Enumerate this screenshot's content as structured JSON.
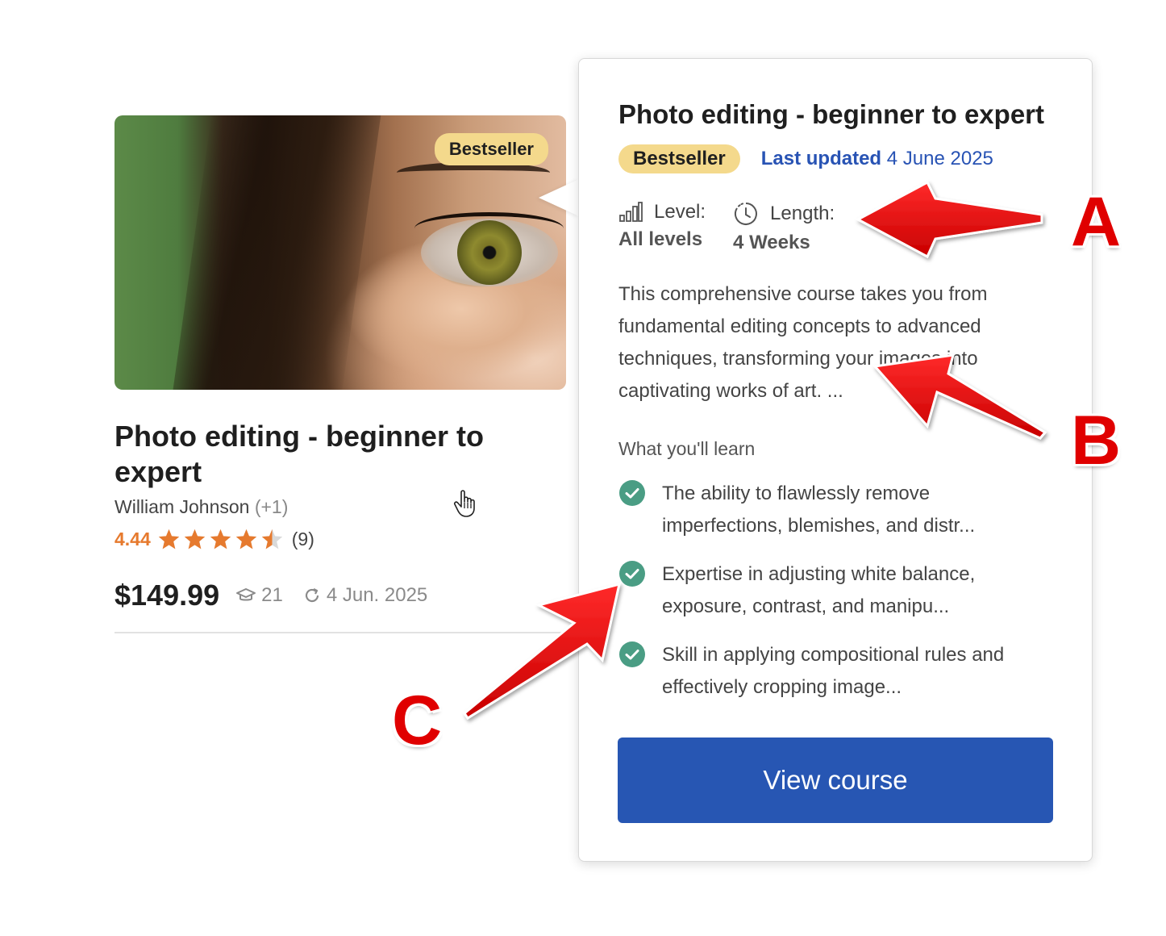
{
  "course_card": {
    "badge": "Bestseller",
    "title": "Photo editing - beginner to expert",
    "author": "William Johnson",
    "author_extra": "(+1)",
    "rating": "4.44",
    "rating_value": 4.44,
    "rating_max": 5,
    "reviews": "(9)",
    "price": "$149.99",
    "students": "21",
    "updated": "4 Jun. 2025"
  },
  "popover": {
    "title": "Photo editing - beginner to expert",
    "badge": "Bestseller",
    "last_updated_label": "Last updated",
    "last_updated_date": "4 June 2025",
    "level_label": "Level:",
    "level_value": "All levels",
    "length_label": "Length:",
    "length_value": "4 Weeks",
    "description": "This comprehensive course takes you from fundamental editing concepts to advanced techniques, transforming your images into captivating works of art. ...",
    "learn_heading": "What you'll learn",
    "learn_items": [
      "The ability to flawlessly remove imperfections, blemishes, and distr...",
      "Expertise in adjusting white balance, exposure, contrast, and manipu...",
      "Skill in applying compositional rules and effectively cropping image..."
    ],
    "button_label": "View course"
  },
  "annotations": {
    "a": "A",
    "b": "B",
    "c": "C"
  },
  "colors": {
    "accent_blue": "#2756b3",
    "badge_yellow": "#f4d98c",
    "rating_orange": "#e67a2e",
    "check_green": "#4a9d84",
    "arrow_red": "#e00000"
  }
}
